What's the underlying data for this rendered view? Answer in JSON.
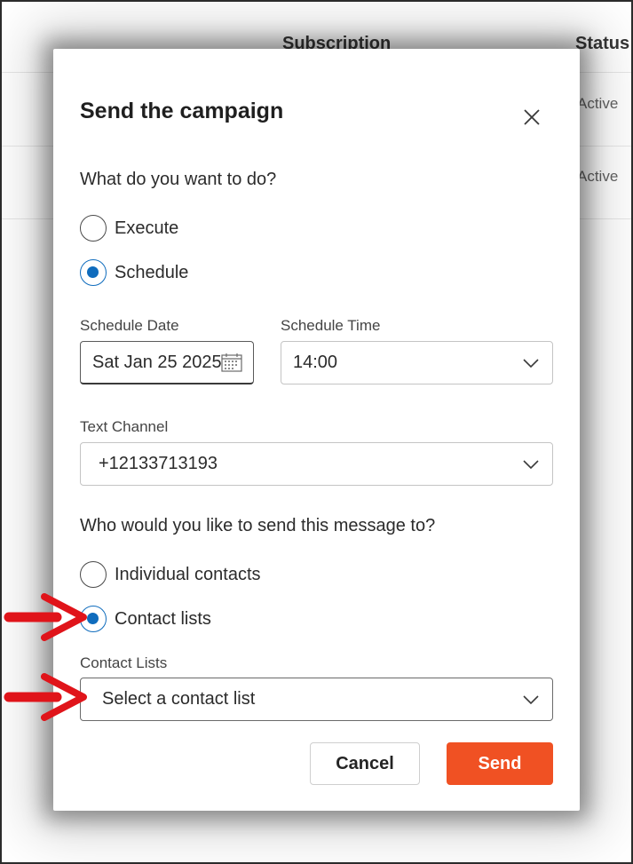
{
  "background_table": {
    "columns": [
      "Subscription",
      "Status"
    ],
    "rows": [
      {
        "status": "Active"
      },
      {
        "status": "Active"
      }
    ]
  },
  "dialog": {
    "title": "Send the campaign",
    "close_icon": "close-icon",
    "action_question": "What do you want to do?",
    "action_options": [
      {
        "label": "Execute",
        "checked": false
      },
      {
        "label": "Schedule",
        "checked": true
      }
    ],
    "schedule_date": {
      "label": "Schedule Date",
      "value": "Sat Jan 25 2025",
      "icon": "calendar-icon"
    },
    "schedule_time": {
      "label": "Schedule Time",
      "value": "14:00"
    },
    "text_channel": {
      "label": "Text Channel",
      "value": "+12133713193"
    },
    "recipient_question": "Who would you like to send this message to?",
    "recipient_options": [
      {
        "label": "Individual contacts",
        "checked": false
      },
      {
        "label": "Contact lists",
        "checked": true
      }
    ],
    "contact_lists": {
      "label": "Contact Lists",
      "placeholder": "Select a contact list"
    },
    "cancel_label": "Cancel",
    "send_label": "Send"
  },
  "annotations": {
    "arrow_color": "#e0141a",
    "arrows": [
      "arrow-right-icon",
      "arrow-right-icon"
    ]
  },
  "colors": {
    "accent": "#0f6cbd",
    "send_button": "#f05123"
  }
}
